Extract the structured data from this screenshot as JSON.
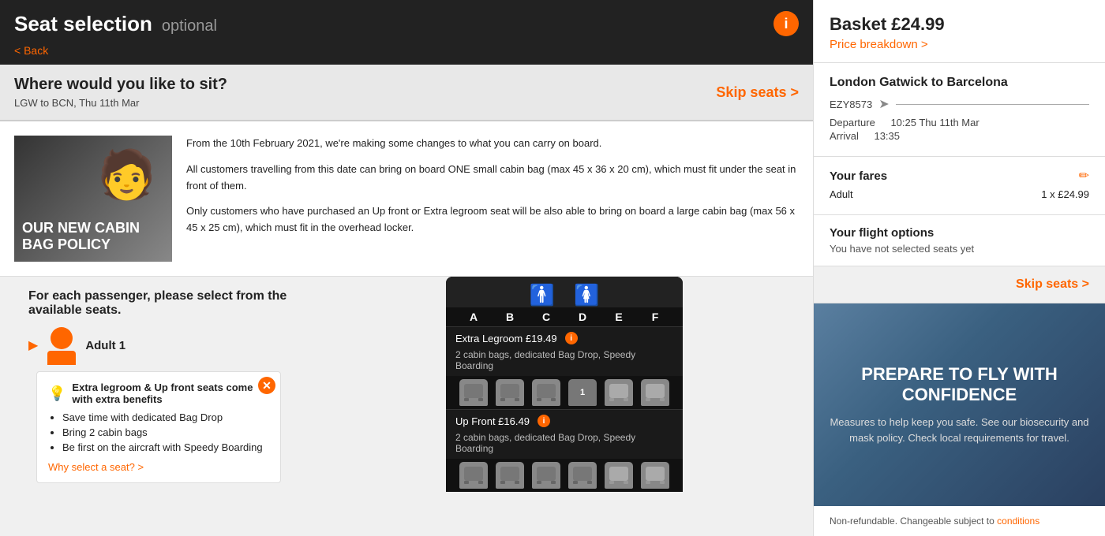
{
  "header": {
    "title": "Seat selection",
    "optional_label": "optional",
    "back_label": "< Back",
    "info_icon": "i"
  },
  "seat_selection": {
    "heading": "Where would you like to sit?",
    "subheading": "LGW to BCN, Thu 11th Mar",
    "skip_seats": "Skip seats >"
  },
  "cabin_bag_policy": {
    "image_text": "OUR NEW CABIN BAG POLICY",
    "paragraph1": "From the 10th February 2021, we're making some changes to what you can carry on board.",
    "paragraph2": "All customers travelling from this date can bring on board ONE small cabin bag (max 45 x 36 x 20 cm), which must fit under the seat in front of them.",
    "paragraph3": "Only customers who have purchased an Up front or Extra legroom seat will be also able to bring on board a large cabin bag (max 56 x 45 x 25 cm), which must fit in the overhead locker."
  },
  "passenger_section": {
    "heading": "For each passenger, please select from the available seats.",
    "passenger_label": "Adult 1"
  },
  "tooltip": {
    "title": "Extra legroom & Up front seats come with extra benefits",
    "benefit1": "Save time with dedicated Bag Drop",
    "benefit2": "Bring 2 cabin bags",
    "benefit3": "Be first on the aircraft with Speedy Boarding",
    "why_link": "Why select a seat? >"
  },
  "seat_map": {
    "col_labels": [
      "A",
      "B",
      "C",
      "D",
      "E",
      "F"
    ],
    "section1": {
      "label": "Extra Legroom £19.49",
      "sublabel": "2 cabin bags, dedicated Bag Drop, Speedy Boarding"
    },
    "section2": {
      "label": "Up Front £16.49",
      "sublabel": "2 cabin bags, dedicated Bag Drop, Speedy Boarding"
    }
  },
  "sidebar": {
    "basket_label": "Basket £24.99",
    "price_breakdown": "Price breakdown >",
    "flight_route": "London Gatwick to Barcelona",
    "flight_number": "EZY8573",
    "departure_label": "Departure",
    "departure_time": "10:25 Thu 11th Mar",
    "arrival_label": "Arrival",
    "arrival_time": "13:35",
    "fares_title": "Your fares",
    "adult_label": "Adult",
    "adult_price": "1 x £24.99",
    "options_title": "Your flight options",
    "options_text": "You have not selected seats yet",
    "skip_seats": "Skip seats >",
    "promo_title": "PREPARE TO FLY WITH CONFIDENCE",
    "promo_subtitle": "Measures to help keep you safe. See our biosecurity and mask policy. Check local requirements for travel.",
    "nonrefundable": "Non-refundable. Changeable subject to"
  }
}
